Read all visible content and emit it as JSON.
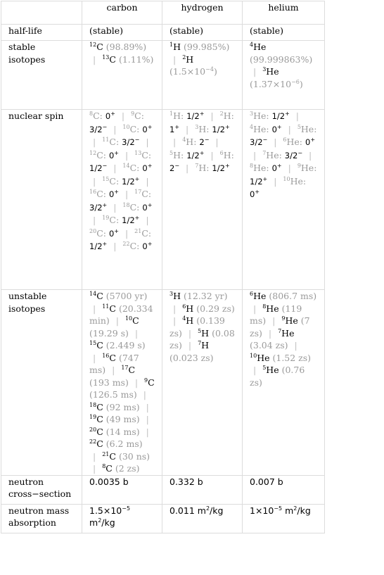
{
  "columns": [
    "carbon",
    "hydrogen",
    "helium"
  ],
  "rows": {
    "half_life": {
      "label": "half-life",
      "values": [
        "(stable)",
        "(stable)",
        "(stable)"
      ]
    },
    "stable_isotopes": {
      "label": "stable isotopes",
      "carbon": [
        {
          "mass": "12",
          "sym": "C",
          "note": "(98.89%)"
        },
        {
          "mass": "13",
          "sym": "C",
          "note": "(1.11%)"
        }
      ],
      "hydrogen": [
        {
          "mass": "1",
          "sym": "H",
          "note": "(99.985%)"
        },
        {
          "mass": "2",
          "sym": "H",
          "note": "(1.5×10",
          "note_exp": "−4",
          "note_end": ")"
        }
      ],
      "helium": [
        {
          "mass": "4",
          "sym": "He",
          "note": "(99.999863%)"
        },
        {
          "mass": "3",
          "sym": "He",
          "note": "(1.37×10",
          "note_exp": "−6",
          "note_end": ")"
        }
      ]
    },
    "nuclear_spin": {
      "label": "nuclear spin",
      "carbon": [
        {
          "mass": "8",
          "sym": "C",
          "spin": "0",
          "parity": "+"
        },
        {
          "mass": "9",
          "sym": "C",
          "spin": "3/2",
          "parity": "−"
        },
        {
          "mass": "10",
          "sym": "C",
          "spin": "0",
          "parity": "+"
        },
        {
          "mass": "11",
          "sym": "C",
          "spin": "3/2",
          "parity": "−"
        },
        {
          "mass": "12",
          "sym": "C",
          "spin": "0",
          "parity": "+"
        },
        {
          "mass": "13",
          "sym": "C",
          "spin": "1/2",
          "parity": "−"
        },
        {
          "mass": "14",
          "sym": "C",
          "spin": "0",
          "parity": "+"
        },
        {
          "mass": "15",
          "sym": "C",
          "spin": "1/2",
          "parity": "+"
        },
        {
          "mass": "16",
          "sym": "C",
          "spin": "0",
          "parity": "+"
        },
        {
          "mass": "17",
          "sym": "C",
          "spin": "3/2",
          "parity": "+"
        },
        {
          "mass": "18",
          "sym": "C",
          "spin": "0",
          "parity": "+"
        },
        {
          "mass": "19",
          "sym": "C",
          "spin": "1/2",
          "parity": "+"
        },
        {
          "mass": "20",
          "sym": "C",
          "spin": "0",
          "parity": "+"
        },
        {
          "mass": "21",
          "sym": "C",
          "spin": "1/2",
          "parity": "+"
        },
        {
          "mass": "22",
          "sym": "C",
          "spin": "0",
          "parity": "+"
        }
      ],
      "hydrogen": [
        {
          "mass": "1",
          "sym": "H",
          "spin": "1/2",
          "parity": "+"
        },
        {
          "mass": "2",
          "sym": "H",
          "spin": "1",
          "parity": "+"
        },
        {
          "mass": "3",
          "sym": "H",
          "spin": "1/2",
          "parity": "+"
        },
        {
          "mass": "4",
          "sym": "H",
          "spin": "2",
          "parity": "−"
        },
        {
          "mass": "5",
          "sym": "H",
          "spin": "1/2",
          "parity": "+"
        },
        {
          "mass": "6",
          "sym": "H",
          "spin": "2",
          "parity": "−"
        },
        {
          "mass": "7",
          "sym": "H",
          "spin": "1/2",
          "parity": "+"
        }
      ],
      "helium": [
        {
          "mass": "3",
          "sym": "He",
          "spin": "1/2",
          "parity": "+"
        },
        {
          "mass": "4",
          "sym": "He",
          "spin": "0",
          "parity": "+"
        },
        {
          "mass": "5",
          "sym": "He",
          "spin": "3/2",
          "parity": "−"
        },
        {
          "mass": "6",
          "sym": "He",
          "spin": "0",
          "parity": "+"
        },
        {
          "mass": "7",
          "sym": "He",
          "spin": "3/2",
          "parity": "−"
        },
        {
          "mass": "8",
          "sym": "He",
          "spin": "0",
          "parity": "+"
        },
        {
          "mass": "9",
          "sym": "He",
          "spin": "1/2",
          "parity": "+"
        },
        {
          "mass": "10",
          "sym": "He",
          "spin": "0",
          "parity": "+"
        }
      ]
    },
    "unstable_isotopes": {
      "label": "unstable isotopes",
      "carbon": [
        {
          "mass": "14",
          "sym": "C",
          "note": "(5700 yr)"
        },
        {
          "mass": "11",
          "sym": "C",
          "note": "(20.334 min)"
        },
        {
          "mass": "10",
          "sym": "C",
          "note": "(19.29 s)"
        },
        {
          "mass": "15",
          "sym": "C",
          "note": "(2.449 s)"
        },
        {
          "mass": "16",
          "sym": "C",
          "note": "(747 ms)"
        },
        {
          "mass": "17",
          "sym": "C",
          "note": "(193 ms)"
        },
        {
          "mass": "9",
          "sym": "C",
          "note": "(126.5 ms)"
        },
        {
          "mass": "18",
          "sym": "C",
          "note": "(92 ms)"
        },
        {
          "mass": "19",
          "sym": "C",
          "note": "(49 ms)"
        },
        {
          "mass": "20",
          "sym": "C",
          "note": "(14 ms)"
        },
        {
          "mass": "22",
          "sym": "C",
          "note": "(6.2 ms)"
        },
        {
          "mass": "21",
          "sym": "C",
          "note": "(30 ns)"
        },
        {
          "mass": "8",
          "sym": "C",
          "note": "(2 zs)"
        }
      ],
      "hydrogen": [
        {
          "mass": "3",
          "sym": "H",
          "note": "(12.32 yr)"
        },
        {
          "mass": "6",
          "sym": "H",
          "note": "(0.29 zs)"
        },
        {
          "mass": "4",
          "sym": "H",
          "note": "(0.139 zs)"
        },
        {
          "mass": "5",
          "sym": "H",
          "note": "(0.08 zs)"
        },
        {
          "mass": "7",
          "sym": "H",
          "note": "(0.023 zs)"
        }
      ],
      "helium": [
        {
          "mass": "6",
          "sym": "He",
          "note": "(806.7 ms)"
        },
        {
          "mass": "8",
          "sym": "He",
          "note": "(119 ms)"
        },
        {
          "mass": "9",
          "sym": "He",
          "note": "(7 zs)"
        },
        {
          "mass": "7",
          "sym": "He",
          "note": "(3.04 zs)"
        },
        {
          "mass": "10",
          "sym": "He",
          "note": "(1.52 zs)"
        },
        {
          "mass": "5",
          "sym": "He",
          "note": "(0.76 zs)"
        }
      ]
    },
    "neutron_cross_section": {
      "label": "neutron cross−section",
      "values": [
        "0.0035 b",
        "0.332 b",
        "0.007 b"
      ]
    },
    "neutron_mass_absorption": {
      "label": "neutron mass absorption",
      "values": [
        {
          "mant": "1.5×10",
          "exp": "−5",
          "unit": "m",
          "unit_exp": "2",
          "unit_end": "/kg"
        },
        {
          "mant": "0.011",
          "exp": "",
          "unit": "m",
          "unit_exp": "2",
          "unit_end": "/kg"
        },
        {
          "mant": "1×10",
          "exp": "−5",
          "unit": "m",
          "unit_exp": "2",
          "unit_end": "/kg"
        }
      ]
    }
  },
  "separator": "|"
}
